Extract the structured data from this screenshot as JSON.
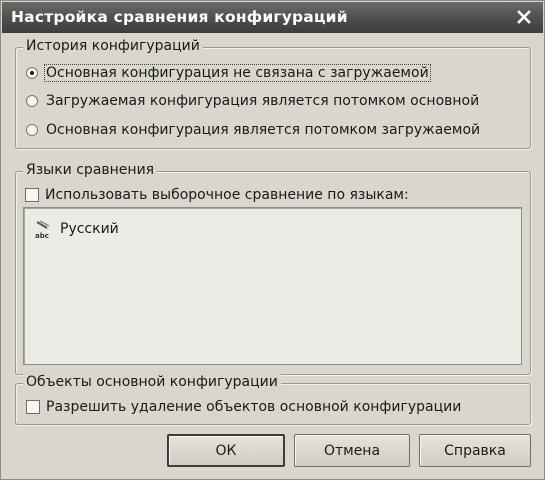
{
  "window": {
    "title": "Настройка сравнения конфигураций"
  },
  "history_group": {
    "label": "История конфигураций",
    "options": [
      {
        "label": "Основная конфигурация не связана с загружаемой",
        "selected": true
      },
      {
        "label": "Загружаемая конфигурация является потомком основной",
        "selected": false
      },
      {
        "label": "Основная конфигурация является потомком загружаемой",
        "selected": false
      }
    ]
  },
  "languages_group": {
    "label": "Языки сравнения",
    "checkbox_label": "Использовать выборочное сравнение по языкам:",
    "checked": false,
    "languages": [
      {
        "label": "Русский",
        "icon": "language-icon"
      }
    ]
  },
  "objects_group": {
    "label": "Объекты основной конфигурации",
    "checkbox_label": "Разрешить удаление объектов основной конфигурации",
    "checked": false
  },
  "buttons": {
    "ok": "ОК",
    "cancel": "Отмена",
    "help": "Справка"
  }
}
